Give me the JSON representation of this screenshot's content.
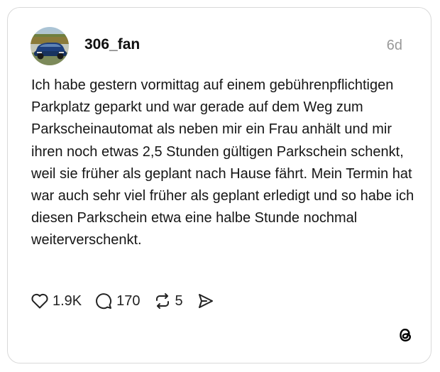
{
  "post": {
    "username": "306_fan",
    "time": "6d",
    "text": "Ich habe gestern vormittag auf einem gebührenpflichtigen Parkplatz geparkt und war gerade auf dem Weg zum Parkscheinautomat als neben mir ein Frau anhält und mir ihren noch etwas 2,5 Stunden gültigen Parkschein schenkt, weil sie früher als geplant nach Hause fährt. Mein Termin hat war auch sehr viel früher als geplant erledigt und so habe ich diesen Parkschein etwa eine halbe Stunde nochmal weiterverschenkt."
  },
  "actions": {
    "likes": "1.9K",
    "replies": "170",
    "reposts": "5"
  },
  "icons": {
    "like": "heart-icon",
    "reply": "speech-bubble-icon",
    "repost": "repost-icon",
    "share": "send-icon",
    "brand": "threads-logo-icon"
  },
  "colors": {
    "text": "#101010",
    "muted": "#999999",
    "border": "#d9d9d9"
  }
}
